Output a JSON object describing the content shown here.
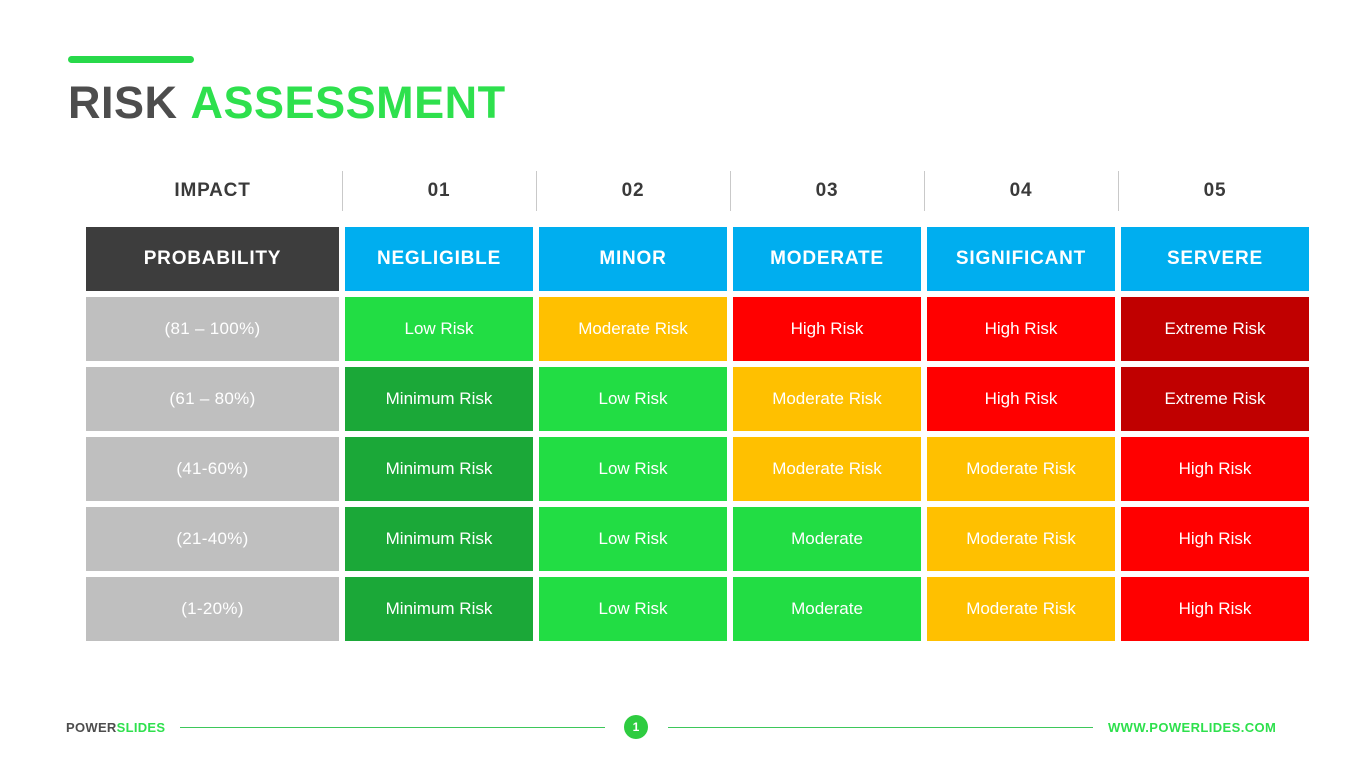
{
  "slide": {
    "title_part1": "RISK",
    "title_part2": "ASSESSMENT",
    "accent_color": "#28d94a"
  },
  "matrix": {
    "impact_header": {
      "label": "IMPACT",
      "numbers": [
        "01",
        "02",
        "03",
        "04",
        "05"
      ]
    },
    "category_header": {
      "probability_label": "PROBABILITY",
      "categories": [
        "NEGLIGIBLE",
        "MINOR",
        "MODERATE",
        "SIGNIFICANT",
        "SERVERE"
      ],
      "dark_color": "#3d3d3d",
      "blue_color": "#00aeef"
    },
    "probability_labels": [
      "(81 – 100%)",
      "(61 – 80%)",
      "(41-60%)",
      "(21-40%)",
      "(1-20%)"
    ],
    "probability_cell_color": "#bfbfbf",
    "risk_colors": {
      "minimum": "#1ba838",
      "low": "#22dd44",
      "moderate": "#ffc000",
      "high": "#ff0000",
      "extreme": "#c00000"
    },
    "rows": [
      {
        "cells": [
          {
            "label": "Low Risk",
            "level": "low"
          },
          {
            "label": "Moderate Risk",
            "level": "moderate"
          },
          {
            "label": "High Risk",
            "level": "high"
          },
          {
            "label": "High Risk",
            "level": "high"
          },
          {
            "label": "Extreme Risk",
            "level": "extreme"
          }
        ]
      },
      {
        "cells": [
          {
            "label": "Minimum Risk",
            "level": "minimum"
          },
          {
            "label": "Low Risk",
            "level": "low"
          },
          {
            "label": "Moderate Risk",
            "level": "moderate"
          },
          {
            "label": "High Risk",
            "level": "high"
          },
          {
            "label": "Extreme Risk",
            "level": "extreme"
          }
        ]
      },
      {
        "cells": [
          {
            "label": "Minimum Risk",
            "level": "minimum"
          },
          {
            "label": "Low Risk",
            "level": "low"
          },
          {
            "label": "Moderate Risk",
            "level": "moderate"
          },
          {
            "label": "Moderate Risk",
            "level": "moderate"
          },
          {
            "label": "High Risk",
            "level": "high"
          }
        ]
      },
      {
        "cells": [
          {
            "label": "Minimum Risk",
            "level": "minimum"
          },
          {
            "label": "Low Risk",
            "level": "low"
          },
          {
            "label": "Moderate",
            "level": "low"
          },
          {
            "label": "Moderate Risk",
            "level": "moderate"
          },
          {
            "label": "High Risk",
            "level": "high"
          }
        ]
      },
      {
        "cells": [
          {
            "label": "Minimum Risk",
            "level": "minimum"
          },
          {
            "label": "Low Risk",
            "level": "low"
          },
          {
            "label": "Moderate",
            "level": "low"
          },
          {
            "label": "Moderate Risk",
            "level": "moderate"
          },
          {
            "label": "High Risk",
            "level": "high"
          }
        ]
      }
    ]
  },
  "footer": {
    "brand_part1": "POWER",
    "brand_part2": "SLIDES",
    "page_number": "1",
    "url": "WWW.POWERLIDES.COM"
  }
}
